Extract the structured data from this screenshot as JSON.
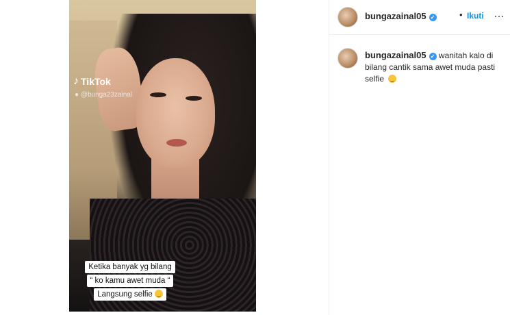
{
  "post": {
    "video": {
      "watermark": {
        "brand": "TikTok",
        "handle": "@bunga23zainal"
      },
      "caption_lines": [
        "Ketika banyak yg bilang",
        "“ ko kamu awet muda “",
        "Langsung selfie"
      ]
    },
    "header": {
      "username": "bungazainal05",
      "verified": "✓",
      "separator": "•",
      "follow_label": "Ikuti",
      "more_label": "…"
    },
    "caption": {
      "username": "bungazainal05",
      "verified": "✓",
      "text": "wanitah kalo di bilang cantik sama awet muda pasti selfie"
    }
  },
  "colors": {
    "link": "#0095f6",
    "verified": "#3897f0",
    "text": "#262626"
  }
}
